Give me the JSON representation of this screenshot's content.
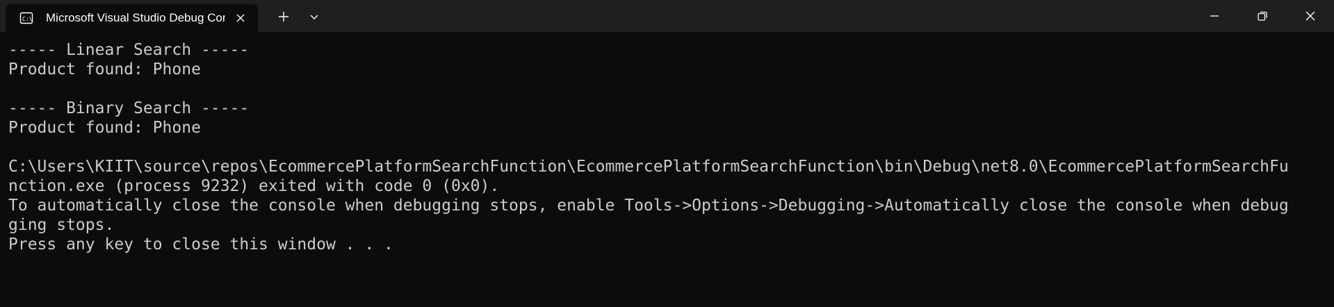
{
  "window": {
    "tab_title": "Microsoft Visual Studio Debug Console",
    "tab_icon": "console-icon",
    "colors": {
      "titlebar": "#1f1f1f",
      "console_bg": "#0c0c0c",
      "console_text": "#cccccc",
      "tab_text": "#ffffff"
    }
  },
  "titlebar": {
    "icons": {
      "tab_close": "close-icon",
      "new_tab": "plus-icon",
      "dropdown": "chevron-down-icon",
      "minimize": "minimize-icon",
      "maximize": "restore-icon",
      "close": "close-icon"
    }
  },
  "console": {
    "lines": [
      "----- Linear Search -----",
      "Product found: Phone",
      "",
      "----- Binary Search -----",
      "Product found: Phone",
      "",
      "C:\\Users\\KIIT\\source\\repos\\EcommercePlatformSearchFunction\\EcommercePlatformSearchFunction\\bin\\Debug\\net8.0\\EcommercePlatformSearchFu",
      "nction.exe (process 9232) exited with code 0 (0x0).",
      "To automatically close the console when debugging stops, enable Tools->Options->Debugging->Automatically close the console when debug",
      "ging stops.",
      "Press any key to close this window . . ."
    ]
  }
}
